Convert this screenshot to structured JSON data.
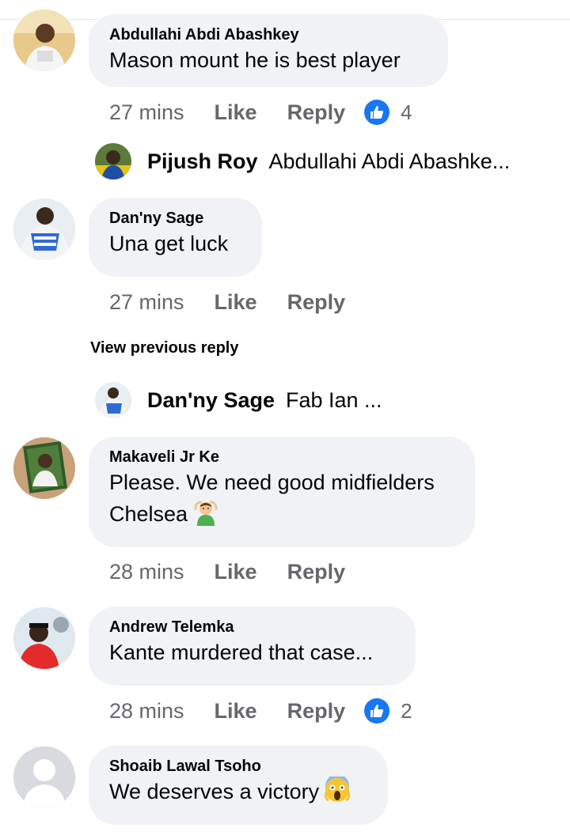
{
  "comments": [
    {
      "name": "Abdullahi Abdi Abashkey",
      "text": "Mason mount he is best player",
      "time": "27 mins",
      "like": "Like",
      "reply": "Reply",
      "reactions": "4"
    },
    {
      "name": "Dan'ny Sage",
      "text": "Una get luck",
      "time": "27 mins",
      "like": "Like",
      "reply": "Reply"
    },
    {
      "name": "Makaveli Jr Ke",
      "text_line1": "Please. We need good midfielders",
      "text_line2": "Chelsea",
      "emoji": "person-gesturing-ok-emoji",
      "time": "28 mins",
      "like": "Like",
      "reply": "Reply"
    },
    {
      "name": "Andrew Telemka",
      "text": "Kante murdered that case...",
      "time": "28 mins",
      "like": "Like",
      "reply": "Reply",
      "reactions": "2"
    },
    {
      "name": "Shoaib Lawal Tsoho",
      "text": "We deserves a victory",
      "emoji": "face-screaming-emoji"
    }
  ],
  "replies": [
    {
      "name": "Pijush Roy",
      "text": "Abdullahi Abdi Abashke..."
    },
    {
      "name": "Dan'ny Sage",
      "text": "Fab Ian ..."
    }
  ],
  "view_previous_reply": "View previous reply",
  "colors": {
    "bubble": "#f0f2f5",
    "meta": "#65676b",
    "like_blue": "#1877f2"
  }
}
